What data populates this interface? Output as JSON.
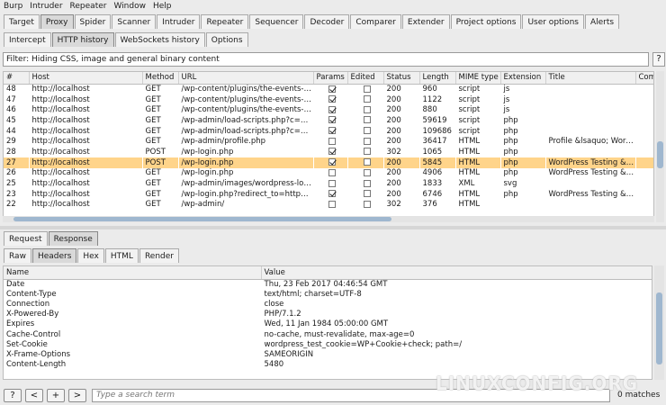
{
  "menu": [
    "Burp",
    "Intruder",
    "Repeater",
    "Window",
    "Help"
  ],
  "main_tabs": [
    {
      "label": "Target",
      "active": false
    },
    {
      "label": "Proxy",
      "active": true
    },
    {
      "label": "Spider",
      "active": false
    },
    {
      "label": "Scanner",
      "active": false
    },
    {
      "label": "Intruder",
      "active": false
    },
    {
      "label": "Repeater",
      "active": false
    },
    {
      "label": "Sequencer",
      "active": false
    },
    {
      "label": "Decoder",
      "active": false
    },
    {
      "label": "Comparer",
      "active": false
    },
    {
      "label": "Extender",
      "active": false
    },
    {
      "label": "Project options",
      "active": false
    },
    {
      "label": "User options",
      "active": false
    },
    {
      "label": "Alerts",
      "active": false
    }
  ],
  "proxy_tabs": [
    {
      "label": "Intercept",
      "active": false
    },
    {
      "label": "HTTP history",
      "active": true
    },
    {
      "label": "WebSockets history",
      "active": false
    },
    {
      "label": "Options",
      "active": false
    }
  ],
  "filter": {
    "text": "Filter: Hiding CSS, image and general binary content",
    "help": "?"
  },
  "history": {
    "columns": [
      "#",
      "Host",
      "Method",
      "URL",
      "Params",
      "Edited",
      "Status",
      "Length",
      "MIME type",
      "Extension",
      "Title",
      "Com"
    ],
    "rows": [
      {
        "id": "48",
        "host": "http://localhost",
        "method": "GET",
        "url": "/wp-content/plugins/the-events-ca...",
        "params": true,
        "edited": false,
        "status": "200",
        "length": "960",
        "mime": "script",
        "ext": "js",
        "title": "",
        "highlight": false
      },
      {
        "id": "47",
        "host": "http://localhost",
        "method": "GET",
        "url": "/wp-content/plugins/the-events-ca...",
        "params": true,
        "edited": false,
        "status": "200",
        "length": "1122",
        "mime": "script",
        "ext": "js",
        "title": "",
        "highlight": false
      },
      {
        "id": "46",
        "host": "http://localhost",
        "method": "GET",
        "url": "/wp-content/plugins/the-events-ca...",
        "params": true,
        "edited": false,
        "status": "200",
        "length": "880",
        "mime": "script",
        "ext": "js",
        "title": "",
        "highlight": false
      },
      {
        "id": "45",
        "host": "http://localhost",
        "method": "GET",
        "url": "/wp-admin/load-scripts.php?c=1&...",
        "params": true,
        "edited": false,
        "status": "200",
        "length": "59619",
        "mime": "script",
        "ext": "php",
        "title": "",
        "highlight": false
      },
      {
        "id": "44",
        "host": "http://localhost",
        "method": "GET",
        "url": "/wp-admin/load-scripts.php?c=1&...",
        "params": true,
        "edited": false,
        "status": "200",
        "length": "109686",
        "mime": "script",
        "ext": "php",
        "title": "",
        "highlight": false
      },
      {
        "id": "29",
        "host": "http://localhost",
        "method": "GET",
        "url": "/wp-admin/profile.php",
        "params": false,
        "edited": false,
        "status": "200",
        "length": "36417",
        "mime": "HTML",
        "ext": "php",
        "title": "Profile &lsaquo; Word...",
        "highlight": false
      },
      {
        "id": "28",
        "host": "http://localhost",
        "method": "POST",
        "url": "/wp-login.php",
        "params": true,
        "edited": false,
        "status": "302",
        "length": "1065",
        "mime": "HTML",
        "ext": "php",
        "title": "",
        "highlight": false
      },
      {
        "id": "27",
        "host": "http://localhost",
        "method": "POST",
        "url": "/wp-login.php",
        "params": true,
        "edited": false,
        "status": "200",
        "length": "5845",
        "mime": "HTML",
        "ext": "php",
        "title": "WordPress Testing &l...",
        "highlight": true
      },
      {
        "id": "26",
        "host": "http://localhost",
        "method": "GET",
        "url": "/wp-login.php",
        "params": false,
        "edited": false,
        "status": "200",
        "length": "4906",
        "mime": "HTML",
        "ext": "php",
        "title": "WordPress Testing &l...",
        "highlight": false
      },
      {
        "id": "25",
        "host": "http://localhost",
        "method": "GET",
        "url": "/wp-admin/images/wordpress-logo...",
        "params": false,
        "edited": false,
        "status": "200",
        "length": "1833",
        "mime": "XML",
        "ext": "svg",
        "title": "",
        "highlight": false
      },
      {
        "id": "23",
        "host": "http://localhost",
        "method": "GET",
        "url": "/wp-login.php?redirect_to=http%3...",
        "params": true,
        "edited": false,
        "status": "200",
        "length": "6746",
        "mime": "HTML",
        "ext": "php",
        "title": "WordPress Testing &l...",
        "highlight": false
      },
      {
        "id": "22",
        "host": "http://localhost",
        "method": "GET",
        "url": "/wp-admin/",
        "params": false,
        "edited": false,
        "status": "302",
        "length": "376",
        "mime": "HTML",
        "ext": "",
        "title": "",
        "highlight": false
      }
    ]
  },
  "req_resp_tabs": [
    {
      "label": "Request",
      "active": false
    },
    {
      "label": "Response",
      "active": true
    }
  ],
  "view_tabs": [
    {
      "label": "Raw",
      "active": false
    },
    {
      "label": "Headers",
      "active": true
    },
    {
      "label": "Hex",
      "active": false
    },
    {
      "label": "HTML",
      "active": false
    },
    {
      "label": "Render",
      "active": false
    }
  ],
  "headers": {
    "columns": [
      "Name",
      "Value"
    ],
    "rows": [
      {
        "name": "Date",
        "value": "Thu, 23 Feb 2017 04:46:54 GMT"
      },
      {
        "name": "Content-Type",
        "value": "text/html; charset=UTF-8"
      },
      {
        "name": "Connection",
        "value": "close"
      },
      {
        "name": "X-Powered-By",
        "value": "PHP/7.1.2"
      },
      {
        "name": "Expires",
        "value": "Wed, 11 Jan 1984 05:00:00 GMT"
      },
      {
        "name": "Cache-Control",
        "value": "no-cache, must-revalidate, max-age=0"
      },
      {
        "name": "Set-Cookie",
        "value": "wordpress_test_cookie=WP+Cookie+check; path=/"
      },
      {
        "name": "X-Frame-Options",
        "value": "SAMEORIGIN"
      },
      {
        "name": "Content-Length",
        "value": "5480"
      }
    ]
  },
  "search": {
    "help": "?",
    "prev": "<",
    "add": "+",
    "next": ">",
    "placeholder": "Type a search term",
    "matches": "0 matches"
  },
  "watermark": "LINUXCONFIG.ORG",
  "colors": {
    "highlight": "#ffd48a",
    "scroll_thumb": "#9fb7cf"
  }
}
